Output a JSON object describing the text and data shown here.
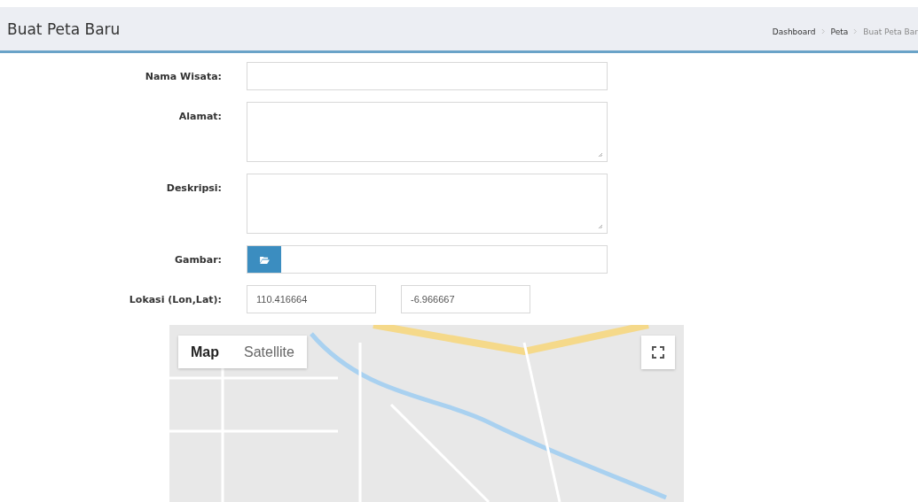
{
  "header": {
    "title": "Buat Peta Baru",
    "breadcrumb": [
      "Dashboard",
      "Peta",
      "Buat Peta Bar"
    ]
  },
  "form": {
    "fields": [
      {
        "kind": "text",
        "label": "Nama Wisata:"
      },
      {
        "kind": "textarea",
        "label": "Alamat:"
      },
      {
        "kind": "textarea",
        "label": "Deskripsi:"
      },
      {
        "kind": "file",
        "label": "Gambar:"
      },
      {
        "kind": "coords",
        "label": "Lokasi (Lon,Lat):",
        "values": [
          "110.416664",
          "-6.966667"
        ]
      }
    ]
  },
  "map": {
    "map_types": [
      {
        "label": "Map",
        "selected": true
      },
      {
        "label": "Satellite",
        "selected": false
      }
    ]
  }
}
